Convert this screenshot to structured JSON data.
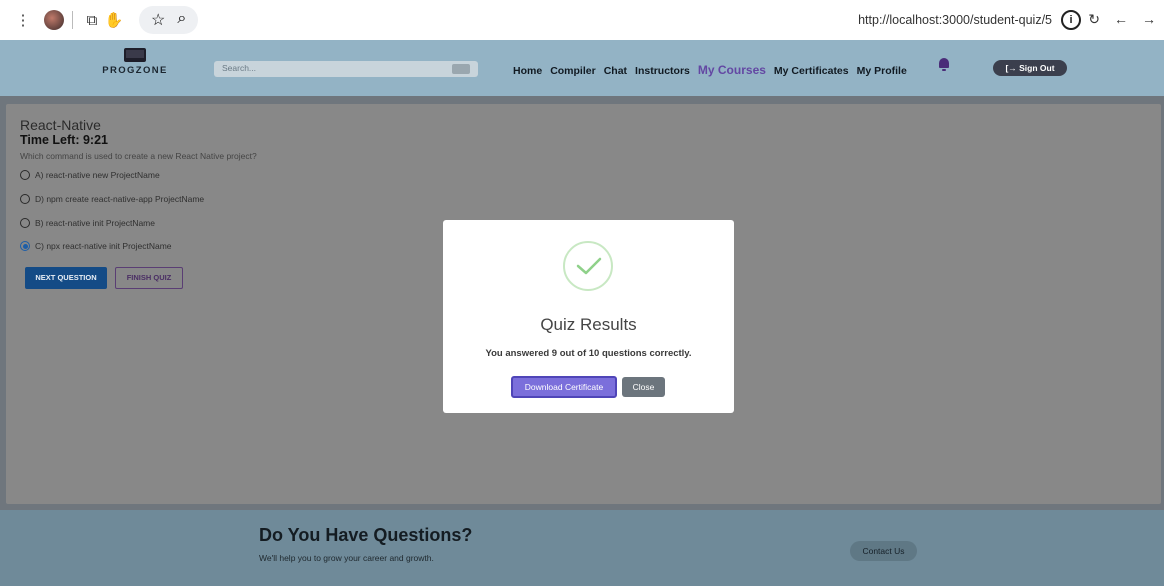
{
  "browser": {
    "url": "http://localhost:3000/student-quiz/5",
    "info_icon_label": "i"
  },
  "navbar": {
    "logo_text": "PROGZONE",
    "search_placeholder": "Search...",
    "links": [
      "Home",
      "Compiler",
      "Chat",
      "Instructors"
    ],
    "active_link": "My Courses",
    "links_after": [
      "My Certificates",
      "My Profile"
    ],
    "sign_out_label": "[→ Sign Out"
  },
  "quiz": {
    "course_title": "React-Native",
    "time_left": "Time Left: 9:21",
    "question": "Which command is used to create a new React Native project?",
    "options": [
      {
        "label": "A) react-native new ProjectName",
        "selected": false
      },
      {
        "label": "D) npm create react-native-app ProjectName",
        "selected": false
      },
      {
        "label": "B) react-native init ProjectName",
        "selected": false
      },
      {
        "label": "C) npx react-native init ProjectName",
        "selected": true
      }
    ],
    "next_label": "NEXT QUESTION",
    "finish_label": "FINISH QUIZ"
  },
  "modal": {
    "title": "Quiz Results",
    "message": "You answered 9 out of 10 questions correctly.",
    "download_label": "Download Certificate",
    "close_label": "Close",
    "icon": "check-circle-icon",
    "accent_color": "#7b6fdb"
  },
  "footer": {
    "title": "Do You Have Questions?",
    "subtitle": "We'll help you to grow your career and growth.",
    "contact_label": "Contact Us"
  }
}
